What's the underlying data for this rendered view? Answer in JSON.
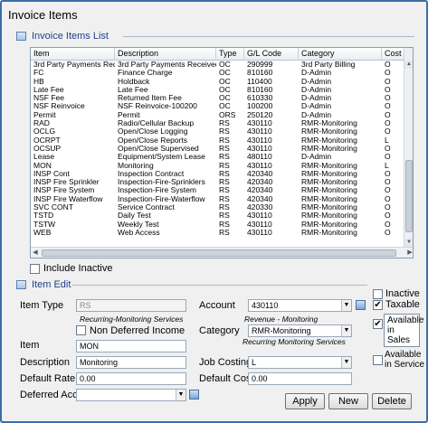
{
  "window": {
    "title": "Invoice Items"
  },
  "list_section": {
    "title": "Invoice Items List"
  },
  "grid": {
    "columns": [
      "Item",
      "Description",
      "Type",
      "G/L Code",
      "Category",
      "Cost T"
    ],
    "rows": [
      [
        "3rd Party Payments Rec'd",
        "3rd Party Payments Received",
        "OC",
        "290999",
        "3rd Party Billing",
        "O"
      ],
      [
        "FC",
        "Finance Charge",
        "OC",
        "810160",
        "D-Admin",
        "O"
      ],
      [
        "HB",
        "Holdback",
        "OC",
        "110400",
        "D-Admin",
        "O"
      ],
      [
        "Late Fee",
        "Late Fee",
        "OC",
        "810160",
        "D-Admin",
        "O"
      ],
      [
        "NSF Fee",
        "Returned Item Fee",
        "OC",
        "610330",
        "D-Admin",
        "O"
      ],
      [
        "NSF Reinvoice",
        "NSF Reinvoice-100200",
        "OC",
        "100200",
        "D-Admin",
        "O"
      ],
      [
        "Permit",
        "Permit",
        "ORS",
        "250120",
        "D-Admin",
        "O"
      ],
      [
        "RAD",
        "Radio/Cellular Backup",
        "RS",
        "430110",
        "RMR-Monitoring",
        "O"
      ],
      [
        "OCLG",
        "Open/Close Logging",
        "RS",
        "430110",
        "RMR-Monitoring",
        "O"
      ],
      [
        "OCRPT",
        "Open/Close Reports",
        "RS",
        "430110",
        "RMR-Monitoring",
        "L"
      ],
      [
        "OCSUP",
        "Open/Close Supervised",
        "RS",
        "430110",
        "RMR-Monitoring",
        "O"
      ],
      [
        "Lease",
        "Equipment/System Lease",
        "RS",
        "480110",
        "D-Admin",
        "O"
      ],
      [
        "MON",
        "Monitoring",
        "RS",
        "430110",
        "RMR-Monitoring",
        "L"
      ],
      [
        "INSP Cont",
        "Inspection Contract",
        "RS",
        "420340",
        "RMR-Monitoring",
        "O"
      ],
      [
        "INSP Fire Sprinkler",
        "Inspection-Fire-Sprinklers",
        "RS",
        "420340",
        "RMR-Monitoring",
        "O"
      ],
      [
        "INSP Fire System",
        "Inspection-Fire System",
        "RS",
        "420340",
        "RMR-Monitoring",
        "O"
      ],
      [
        "INSP Fire Waterflow",
        "Inspection-Fire-Waterflow",
        "RS",
        "420340",
        "RMR-Monitoring",
        "O"
      ],
      [
        "SVC CONT",
        "Service Contract",
        "RS",
        "420330",
        "RMR-Monitoring",
        "O"
      ],
      [
        "TSTD",
        "Daily Test",
        "RS",
        "430110",
        "RMR-Monitoring",
        "O"
      ],
      [
        "TSTW",
        "Weekly Test",
        "RS",
        "430110",
        "RMR-Monitoring",
        "O"
      ],
      [
        "WEB",
        "Web Access",
        "RS",
        "430110",
        "RMR-Monitoring",
        "O"
      ]
    ]
  },
  "include_inactive": {
    "label": "Include Inactive",
    "checked": false
  },
  "edit_section": {
    "title": "Item Edit"
  },
  "form": {
    "item_type_label": "Item Type",
    "item_type_value": "RS",
    "item_type_note": "Recurring-Monitoring Services",
    "non_deferred_label": "Non Deferred Income",
    "item_label": "Item",
    "item_value": "MON",
    "description_label": "Description",
    "description_value": "Monitoring",
    "default_rate_label": "Default Rate",
    "default_rate_value": "0.00",
    "deferred_acct_label": "Deferred Acct",
    "deferred_acct_value": "",
    "account_label": "Account",
    "account_value": "430110",
    "account_note": "Revenue - Monitoring",
    "category_label": "Category",
    "category_value": "RMR-Monitoring",
    "category_note": "Recurring Monitoring Services",
    "job_costing_label": "Job Costing",
    "job_costing_value": "L",
    "default_cost_label": "Default Cost",
    "default_cost_value": "0.00",
    "inactive_label": "Inactive",
    "taxable_label": "Taxable",
    "available_in_sales_label": "Available in Sales",
    "available_in_service_label": "Available in Service"
  },
  "buttons": {
    "apply": "Apply",
    "new": "New",
    "delete": "Delete"
  },
  "colors": {
    "section_title": "#1f3f8a",
    "frame_border": "#3a6ea5"
  }
}
